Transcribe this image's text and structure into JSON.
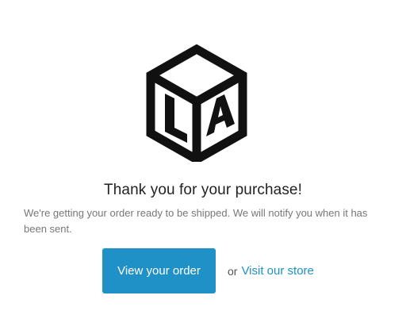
{
  "logo": {
    "letters": [
      "L",
      "A"
    ],
    "icon": "la-cube-logo"
  },
  "heading": "Thank you for your purchase!",
  "message": "We're getting your order ready to be shipped. We will notify you when it has been sent.",
  "actions": {
    "primary_label": "View your order",
    "or_label": "or",
    "secondary_label": "Visit our store"
  },
  "colors": {
    "accent": "#1f91c6",
    "heading": "#222222",
    "body_text": "#777777",
    "logo": "#111111"
  }
}
